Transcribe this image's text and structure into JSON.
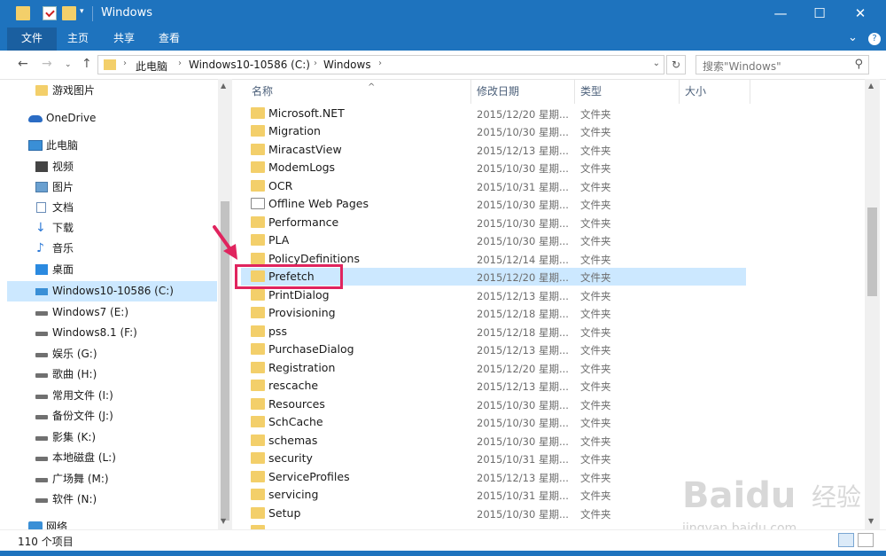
{
  "window": {
    "title": "Windows",
    "minimize_glyph": "—",
    "maximize_glyph": "☐",
    "close_glyph": "✕"
  },
  "ribbon": {
    "tabs": [
      {
        "label": "文件",
        "active": true
      },
      {
        "label": "主页",
        "active": false
      },
      {
        "label": "共享",
        "active": false
      },
      {
        "label": "查看",
        "active": false
      }
    ],
    "expand_glyph": "⌄",
    "help_glyph": "?"
  },
  "address": {
    "breadcrumbs": [
      "此电脑",
      "Windows10-10586 (C:)",
      "Windows"
    ],
    "search_placeholder": "搜索\"Windows\""
  },
  "nav": {
    "items": [
      {
        "label": "游戏图片",
        "icon": "folder-icon",
        "selected": false
      },
      {
        "label": "OneDrive",
        "icon": "onedrive-icon",
        "selected": false
      },
      {
        "label": "此电脑",
        "icon": "computer-icon",
        "selected": false
      },
      {
        "label": "视频",
        "icon": "video-icon",
        "selected": false
      },
      {
        "label": "图片",
        "icon": "pictures-icon",
        "selected": false
      },
      {
        "label": "文档",
        "icon": "documents-icon",
        "selected": false
      },
      {
        "label": "下载",
        "icon": "download-icon",
        "selected": false
      },
      {
        "label": "音乐",
        "icon": "music-icon",
        "selected": false
      },
      {
        "label": "桌面",
        "icon": "desktop-icon",
        "selected": false
      },
      {
        "label": "Windows10-10586 (C:)",
        "icon": "windows-drive-icon",
        "selected": true
      },
      {
        "label": "Windows7 (E:)",
        "icon": "drive-icon",
        "selected": false
      },
      {
        "label": "Windows8.1 (F:)",
        "icon": "drive-icon",
        "selected": false
      },
      {
        "label": "娱乐 (G:)",
        "icon": "drive-icon",
        "selected": false
      },
      {
        "label": "歌曲 (H:)",
        "icon": "drive-icon",
        "selected": false
      },
      {
        "label": "常用文件 (I:)",
        "icon": "drive-icon",
        "selected": false
      },
      {
        "label": "备份文件 (J:)",
        "icon": "drive-icon",
        "selected": false
      },
      {
        "label": "影集 (K:)",
        "icon": "drive-icon",
        "selected": false
      },
      {
        "label": "本地磁盘 (L:)",
        "icon": "drive-icon",
        "selected": false
      },
      {
        "label": "广场舞 (M:)",
        "icon": "drive-icon",
        "selected": false
      },
      {
        "label": "软件 (N:)",
        "icon": "drive-icon",
        "selected": false
      },
      {
        "label": "网络",
        "icon": "network-icon",
        "selected": false
      }
    ]
  },
  "columns": {
    "name": "名称",
    "date": "修改日期",
    "type": "类型",
    "size": "大小"
  },
  "files": [
    {
      "name": "Microsoft.NET",
      "date": "2015/12/20 星期...",
      "type": "文件夹",
      "selected": false
    },
    {
      "name": "Migration",
      "date": "2015/10/30 星期...",
      "type": "文件夹",
      "selected": false
    },
    {
      "name": "MiracastView",
      "date": "2015/12/13 星期...",
      "type": "文件夹",
      "selected": false
    },
    {
      "name": "ModemLogs",
      "date": "2015/10/30 星期...",
      "type": "文件夹",
      "selected": false
    },
    {
      "name": "OCR",
      "date": "2015/10/31 星期...",
      "type": "文件夹",
      "selected": false
    },
    {
      "name": "Offline Web Pages",
      "date": "2015/10/30 星期...",
      "type": "文件夹",
      "selected": false,
      "special": true
    },
    {
      "name": "Performance",
      "date": "2015/10/30 星期...",
      "type": "文件夹",
      "selected": false
    },
    {
      "name": "PLA",
      "date": "2015/10/30 星期...",
      "type": "文件夹",
      "selected": false
    },
    {
      "name": "PolicyDefinitions",
      "date": "2015/12/14 星期...",
      "type": "文件夹",
      "selected": false
    },
    {
      "name": "Prefetch",
      "date": "2015/12/20 星期...",
      "type": "文件夹",
      "selected": true
    },
    {
      "name": "PrintDialog",
      "date": "2015/12/13 星期...",
      "type": "文件夹",
      "selected": false
    },
    {
      "name": "Provisioning",
      "date": "2015/12/18 星期...",
      "type": "文件夹",
      "selected": false
    },
    {
      "name": "pss",
      "date": "2015/12/18 星期...",
      "type": "文件夹",
      "selected": false
    },
    {
      "name": "PurchaseDialog",
      "date": "2015/12/13 星期...",
      "type": "文件夹",
      "selected": false
    },
    {
      "name": "Registration",
      "date": "2015/12/20 星期...",
      "type": "文件夹",
      "selected": false
    },
    {
      "name": "rescache",
      "date": "2015/12/13 星期...",
      "type": "文件夹",
      "selected": false
    },
    {
      "name": "Resources",
      "date": "2015/10/30 星期...",
      "type": "文件夹",
      "selected": false
    },
    {
      "name": "SchCache",
      "date": "2015/10/30 星期...",
      "type": "文件夹",
      "selected": false
    },
    {
      "name": "schemas",
      "date": "2015/10/30 星期...",
      "type": "文件夹",
      "selected": false
    },
    {
      "name": "security",
      "date": "2015/10/31 星期...",
      "type": "文件夹",
      "selected": false
    },
    {
      "name": "ServiceProfiles",
      "date": "2015/12/13 星期...",
      "type": "文件夹",
      "selected": false
    },
    {
      "name": "servicing",
      "date": "2015/10/31 星期...",
      "type": "文件夹",
      "selected": false
    },
    {
      "name": "Setup",
      "date": "2015/10/30 星期...",
      "type": "文件夹",
      "selected": false
    }
  ],
  "status": {
    "item_count": "110 个项目"
  },
  "watermark": {
    "brand": "Baidu",
    "brand_cn": "经验",
    "url": "jingyan.baidu.com"
  },
  "colors": {
    "titlebar": "#1e73be",
    "selection": "#cce8ff",
    "highlight": "#e0245e",
    "folder": "#f3cf6a"
  }
}
